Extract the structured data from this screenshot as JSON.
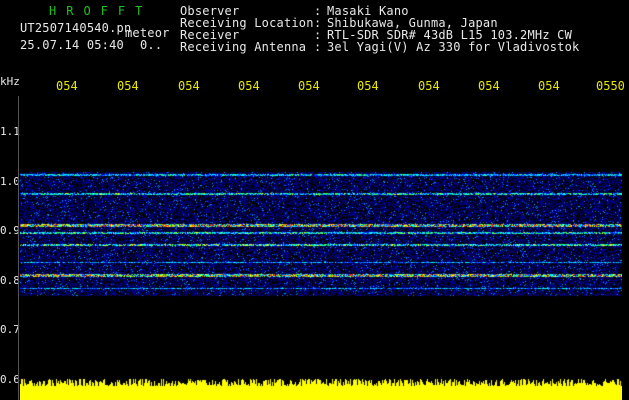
{
  "header": {
    "brand": "HROFFT",
    "file_name": "UT2507140540.pn",
    "event_type": "meteor",
    "date_time": "25.07.14 05:40",
    "count_indicator": "0.."
  },
  "info": [
    {
      "label": "Observer",
      "value": "Masaki Kano"
    },
    {
      "label": "Receiving Location",
      "value": "Shibukawa, Gunma, Japan"
    },
    {
      "label": "Receiver",
      "value": "RTL-SDR SDR# 43dB L15 103.2MHz CW"
    },
    {
      "label": "Receiving Antenna",
      "value": "3el Yagi(V) Az 330 for Vladivostok"
    }
  ],
  "time_axis": [
    "054",
    "054",
    "054",
    "054",
    "054",
    "054",
    "054",
    "054",
    "054",
    "0550"
  ],
  "freq_axis": {
    "unit": "kHz",
    "ticks": [
      "1.1",
      "1.0",
      "0.9",
      "0.8",
      "0.7",
      "0.6"
    ]
  },
  "colors": {
    "header_green": "#1ec21e",
    "axis_yellow": "#e8e800",
    "waterfall_bg": "#000000",
    "power_yellow": "#ffff00"
  }
}
